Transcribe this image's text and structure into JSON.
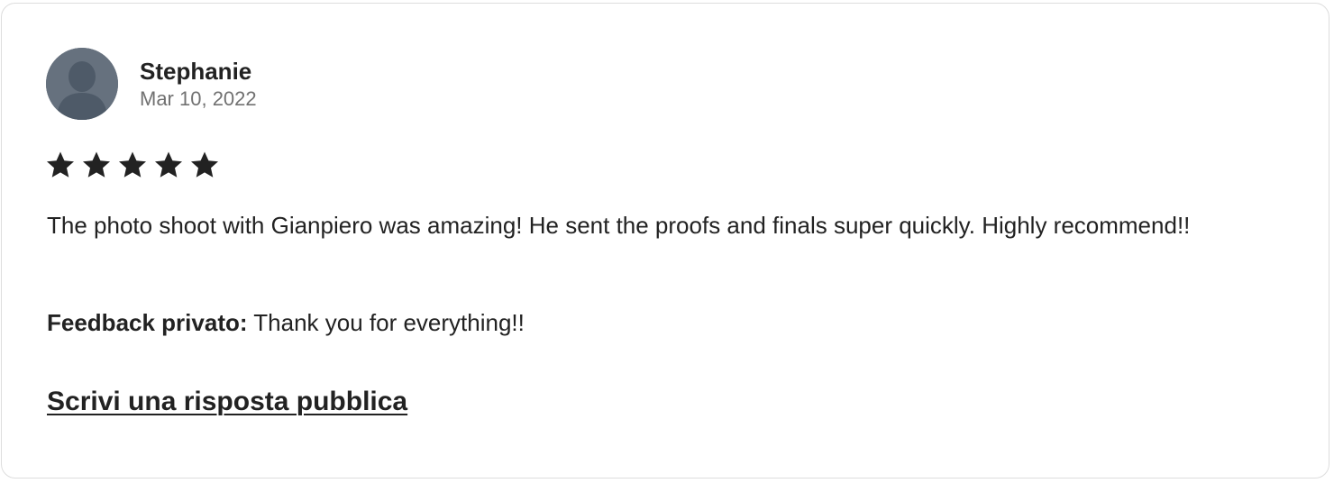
{
  "review": {
    "reviewer_name": "Stephanie",
    "date": "Mar 10, 2022",
    "rating": 5,
    "rating_max": 5,
    "text": "The photo shoot with Gianpiero was amazing! He sent the proofs and finals super quickly. Highly recommend!!",
    "private_feedback_label": "Feedback privato:",
    "private_feedback_text": " Thank you for everything!!",
    "reply_link_label": "Scrivi una risposta pubblica"
  },
  "icons": {
    "avatar": "person-silhouette-icon",
    "star": "star-icon"
  },
  "colors": {
    "text": "#222222",
    "secondary_text": "#717171",
    "border": "#dddddd",
    "avatar_bg": "#5f6b79",
    "avatar_figure": "#4b5866"
  }
}
